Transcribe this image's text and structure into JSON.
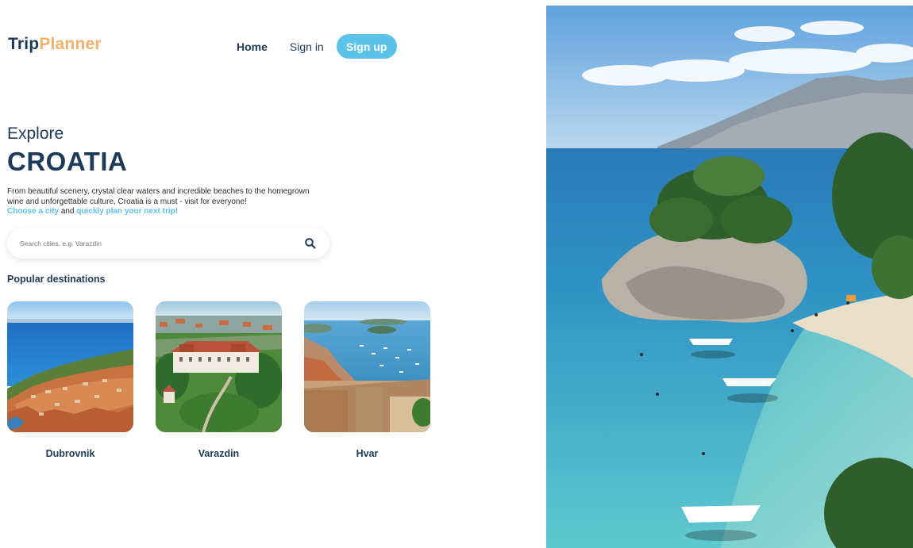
{
  "header": {
    "logo_part1": "Trip",
    "logo_part2": "Planner",
    "nav_home": "Home",
    "nav_signin": "Sign in",
    "signup_label": "Sign up"
  },
  "hero": {
    "explore": "Explore",
    "country": "CROATIA",
    "desc_text": "From beautiful scenery, crystal clear waters and incredible beaches to the homegrown wine and unforgettable culture, Croatia is a must - visit for everyone!",
    "cta_1": "Choose a city",
    "cta_and": "and",
    "cta_2": "quickly plan your next trip!"
  },
  "search": {
    "placeholder": "Search cities, e.g. Varazdin",
    "icon": "search-icon"
  },
  "popular": {
    "title": "Popular destinations",
    "items": [
      {
        "name": "Dubrovnik"
      },
      {
        "name": "Varazdin"
      },
      {
        "name": "Hvar"
      }
    ]
  },
  "colors": {
    "navy": "#1e3a5a",
    "accent_orange": "#f2b06a",
    "accent_blue": "#5cc3e8"
  }
}
